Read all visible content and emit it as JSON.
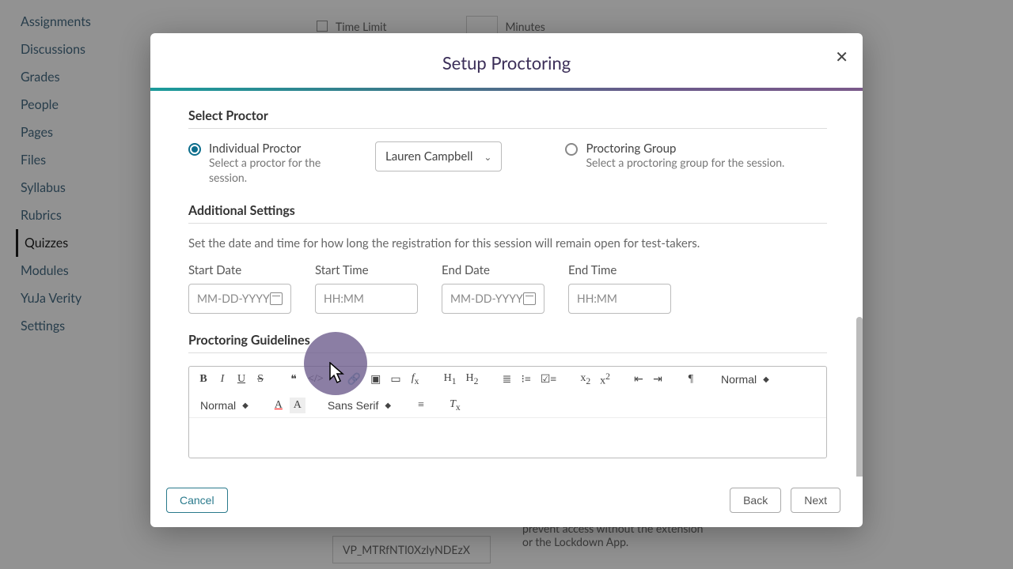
{
  "sidebar": {
    "items": [
      {
        "label": "Assignments"
      },
      {
        "label": "Discussions"
      },
      {
        "label": "Grades"
      },
      {
        "label": "People"
      },
      {
        "label": "Pages"
      },
      {
        "label": "Files"
      },
      {
        "label": "Syllabus"
      },
      {
        "label": "Rubrics"
      },
      {
        "label": "Quizzes"
      },
      {
        "label": "Modules"
      },
      {
        "label": "YuJa Verity"
      },
      {
        "label": "Settings"
      }
    ],
    "active_index": 8
  },
  "background": {
    "time_limit_label": "Time Limit",
    "minutes_label": "Minutes",
    "lockdown_hint": "prevent access without the extension or the Lockdown App.",
    "code_value": "VP_MTRfNTI0XzIyNDEzX"
  },
  "modal": {
    "title": "Setup Proctoring",
    "select_proctor_heading": "Select Proctor",
    "individual": {
      "label": "Individual Proctor",
      "sub": "Select a proctor for the session.",
      "selected_value": "Lauren Campbell"
    },
    "group": {
      "label": "Proctoring Group",
      "sub": "Select a proctoring group for the session."
    },
    "additional_heading": "Additional Settings",
    "additional_help": "Set the date and time for how long the registration for this session will remain open for test-takers.",
    "fields": {
      "start_date_label": "Start Date",
      "start_date_placeholder": "MM-DD-YYYY",
      "start_time_label": "Start Time",
      "start_time_placeholder": "HH:MM",
      "end_date_label": "End Date",
      "end_date_placeholder": "MM-DD-YYYY",
      "end_time_label": "End Time",
      "end_time_placeholder": "HH:MM"
    },
    "guidelines_heading": "Proctoring Guidelines",
    "rte": {
      "size1": "Normal",
      "size2": "Normal",
      "font": "Sans Serif"
    },
    "buttons": {
      "cancel": "Cancel",
      "back": "Back",
      "next": "Next"
    }
  }
}
